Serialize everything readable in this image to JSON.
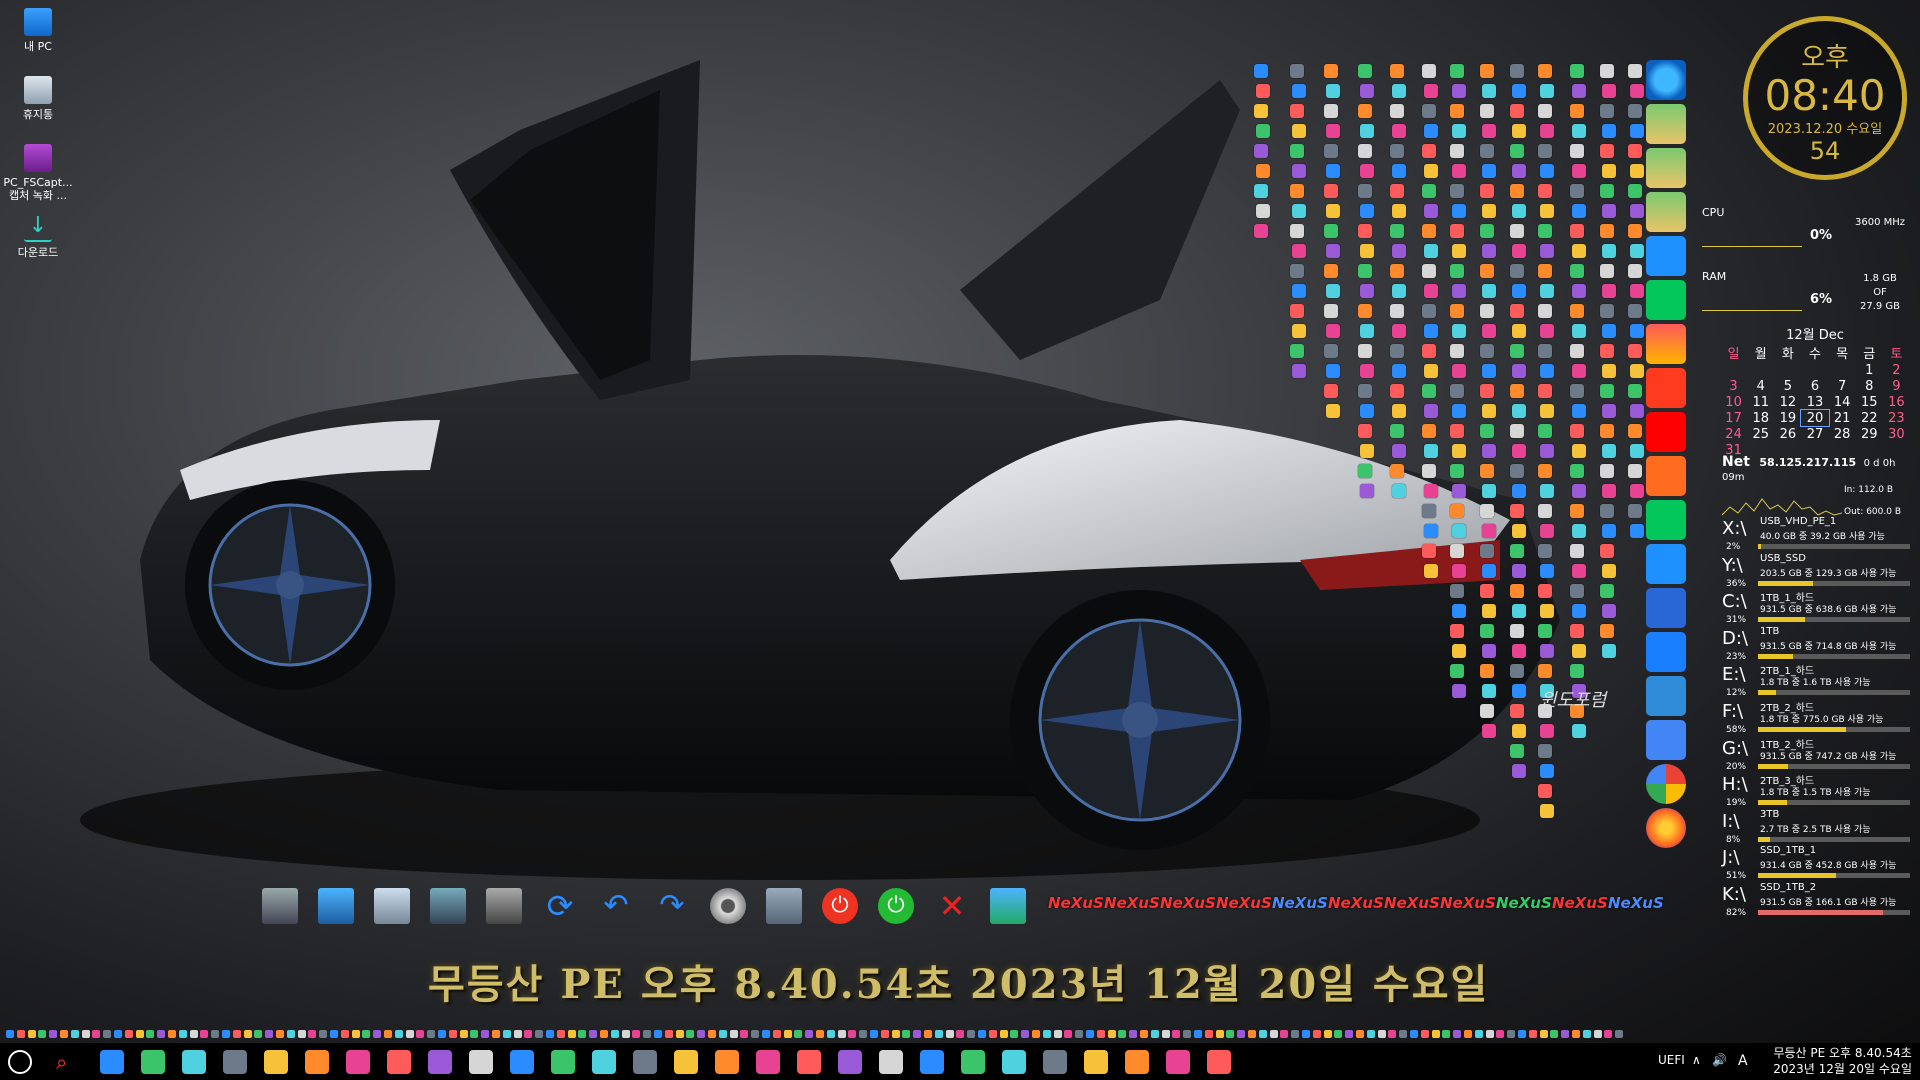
{
  "desktop_icons": [
    {
      "label": "내 PC",
      "icon": "monitor-icon"
    },
    {
      "label": "휴지통",
      "icon": "recycle-bin-icon"
    },
    {
      "label": "PC_FSCapt... 캡처 녹화 ...",
      "icon": "video-file-icon"
    },
    {
      "label": "다운로드",
      "icon": "download-icon"
    }
  ],
  "clock": {
    "ampm": "오후",
    "time": "08:40",
    "date": "2023.12.20 수요일",
    "seconds": "54"
  },
  "cpu": {
    "label": "CPU",
    "percent": "0%",
    "value": "3600 MHz"
  },
  "ram": {
    "label": "RAM",
    "percent": "6%",
    "value1": "1.8 GB",
    "value2": "OF",
    "value3": "27.9 GB"
  },
  "calendar": {
    "caption": "12월 Dec",
    "weekdays": [
      "일",
      "월",
      "화",
      "수",
      "목",
      "금",
      "토"
    ],
    "weeks": [
      [
        "",
        "",
        "",
        "",
        "",
        "1",
        "2"
      ],
      [
        "3",
        "4",
        "5",
        "6",
        "7",
        "8",
        "9"
      ],
      [
        "10",
        "11",
        "12",
        "13",
        "14",
        "15",
        "16"
      ],
      [
        "17",
        "18",
        "19",
        "20",
        "21",
        "22",
        "23"
      ],
      [
        "24",
        "25",
        "26",
        "27",
        "28",
        "29",
        "30"
      ],
      [
        "31",
        "",
        "",
        "",
        "",
        "",
        ""
      ]
    ],
    "today": "20"
  },
  "net": {
    "label": "Net",
    "ip": "58.125.217.115",
    "uptime": "0 d 0h 09m",
    "in": "In: 112.0 B",
    "out": "Out: 600.0 B"
  },
  "drives": [
    {
      "letter": "X:\\",
      "name": "USB_VHD_PE_1",
      "info": "40.0 GB 중  39.2 GB 사용 가능",
      "percent": "2%",
      "fill": 0.02
    },
    {
      "letter": "Y:\\",
      "name": "USB_SSD",
      "info": "203.5 GB 중 129.3 GB 사용 가능",
      "percent": "36%",
      "fill": 0.36
    },
    {
      "letter": "C:\\",
      "name": "1TB_1_하드",
      "info": "931.5 GB 중 638.6 GB 사용 가능",
      "percent": "31%",
      "fill": 0.31
    },
    {
      "letter": "D:\\",
      "name": "1TB",
      "info": "931.5 GB 중 714.8 GB 사용 가능",
      "percent": "23%",
      "fill": 0.23
    },
    {
      "letter": "E:\\",
      "name": "2TB_1_하드",
      "info": "1.8 TB 중    1.6 TB 사용 가능",
      "percent": "12%",
      "fill": 0.12
    },
    {
      "letter": "F:\\",
      "name": "2TB_2_하드",
      "info": "1.8 TB 중  775.0 GB 사용 가능",
      "percent": "58%",
      "fill": 0.58
    },
    {
      "letter": "G:\\",
      "name": "1TB_2_하드",
      "info": "931.5 GB 중 747.2 GB 사용 가능",
      "percent": "20%",
      "fill": 0.2
    },
    {
      "letter": "H:\\",
      "name": "2TB_3_하드",
      "info": "1.8 TB 중    1.5 TB 사용 가능",
      "percent": "19%",
      "fill": 0.19
    },
    {
      "letter": "I:\\",
      "name": "3TB",
      "info": "2.7 TB 중    2.5 TB 사용 가능",
      "percent": "8%",
      "fill": 0.08
    },
    {
      "letter": "J:\\",
      "name": "SSD_1TB_1",
      "info": "931.4 GB 중 452.8 GB 사용 가능",
      "percent": "51%",
      "fill": 0.51
    },
    {
      "letter": "K:\\",
      "name": "SSD_1TB_2",
      "info": "931.5 GB 중 166.1 GB 사용 가능",
      "percent": "82%",
      "fill": 0.82
    }
  ],
  "dock": {
    "nexus_label": "NeXuS"
  },
  "watermark": "윈도포럼",
  "banner": "무등산 PE 오후 8.40.54초 2023년  12월  20일  수요일",
  "taskbar": {
    "uefi": "UEFI",
    "ime": "A",
    "line1": "무등산 PE 오후 8.40.54초",
    "line2": "2023년  12월  20일  수요일"
  },
  "colors": {
    "accent": "#d9b842",
    "drive_normal": "#e8c62a",
    "drive_warn": "#e36a6a"
  }
}
